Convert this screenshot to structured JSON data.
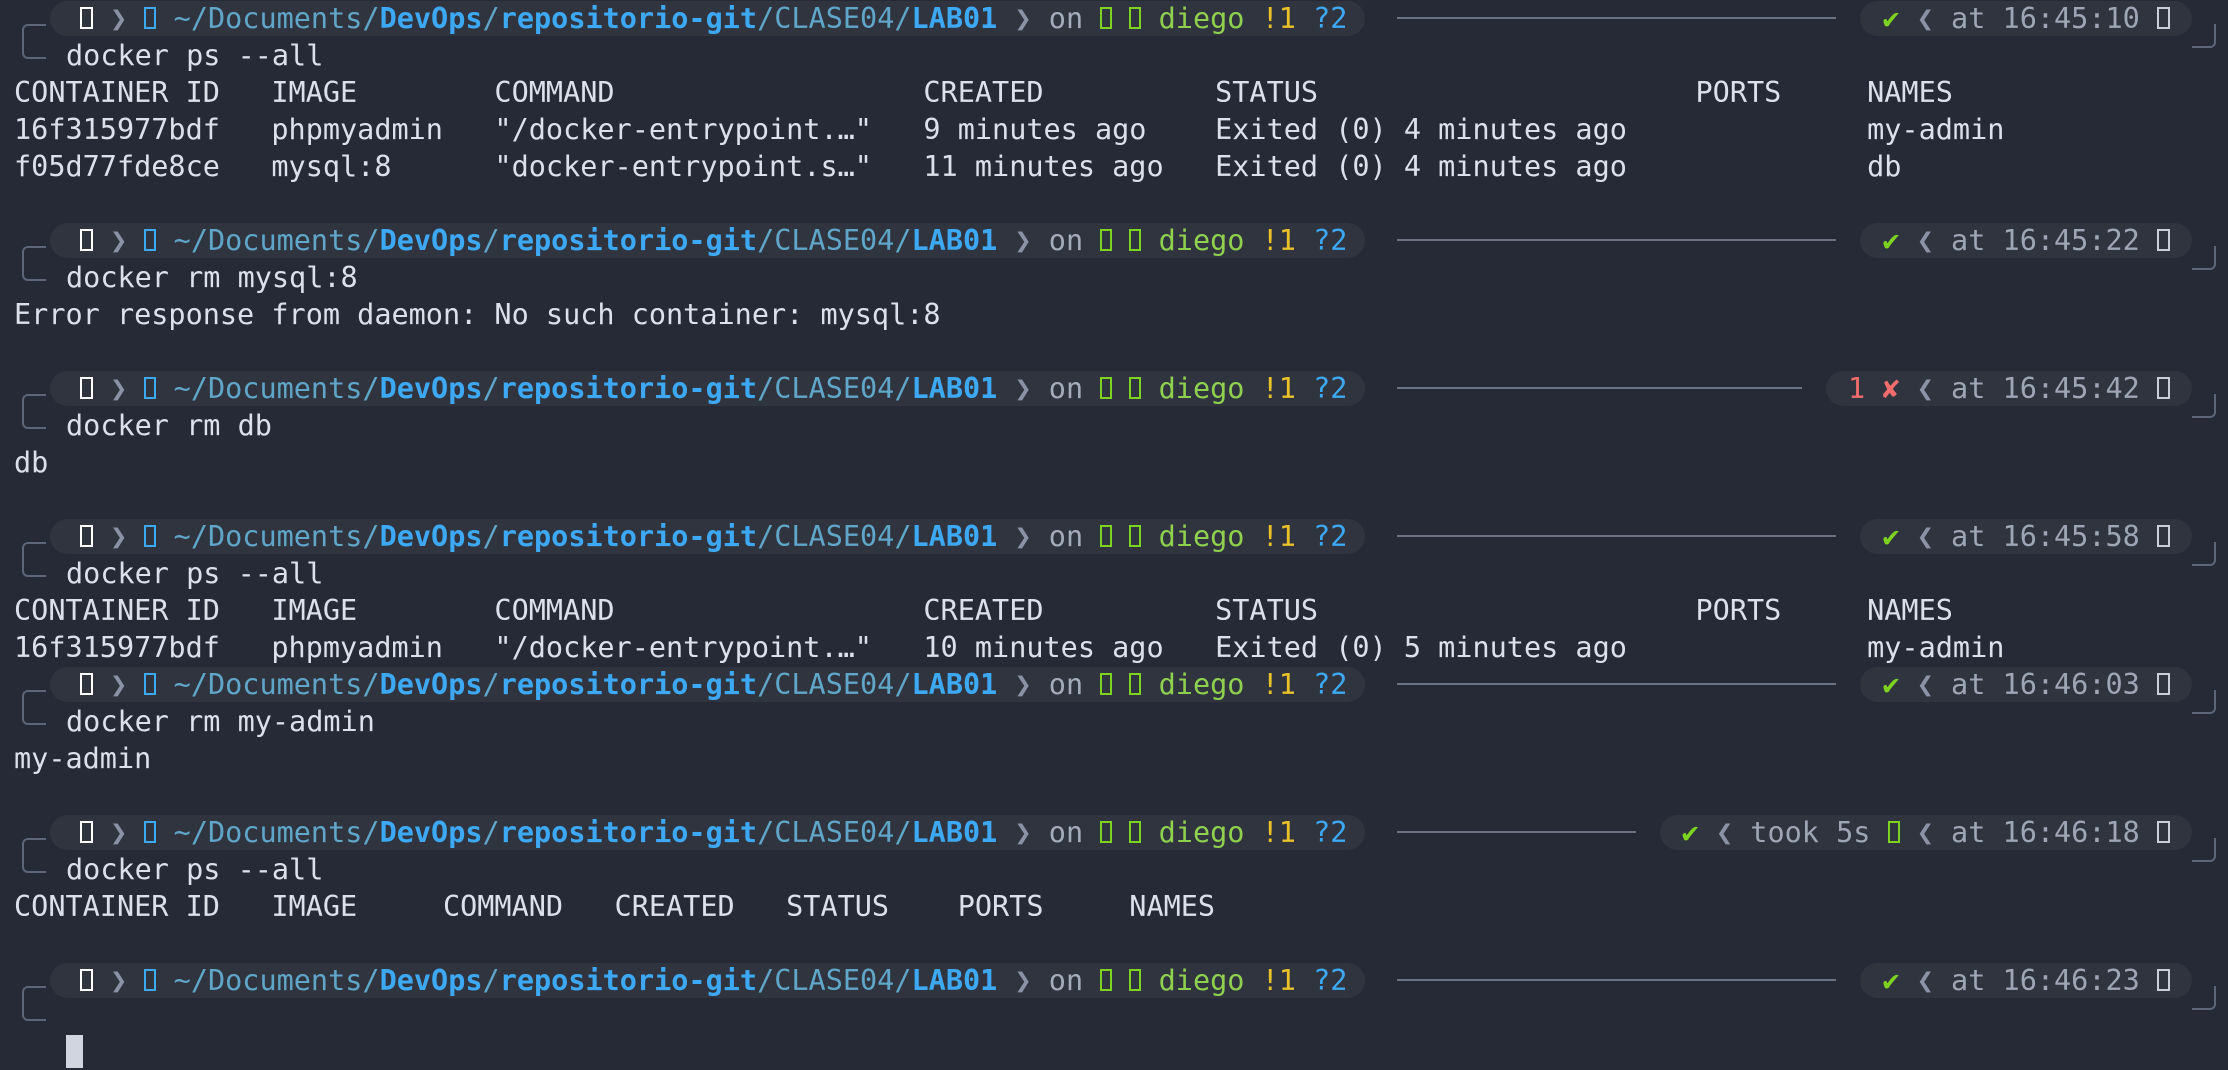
{
  "theme": {
    "background": "#262a37",
    "accent_dir": "#3da9f4",
    "ok_color": "#7ed321",
    "error_color": "#f26d6d",
    "git_dirty_color": "#e9c229"
  },
  "prompt_common": {
    "apple_icon": "apple-logo-icon",
    "folder_icon": "folder-icon",
    "path_parts": [
      "~/Documents/",
      "DevOps",
      "/",
      "repositorio-git",
      "/CLASE04/",
      "LAB01"
    ],
    "on": "on",
    "git_icons": [
      "git-icon",
      "branch-icon"
    ],
    "branch": "diego",
    "modified": "!1",
    "untracked": "?2",
    "at": "at",
    "ok_mark": "✔",
    "fail_mark": "✘",
    "clock_icon": "clock-icon"
  },
  "blocks": [
    {
      "time": "16:45:10",
      "status": "✔",
      "command": "docker ps --all",
      "output": [
        "CONTAINER ID   IMAGE        COMMAND                  CREATED          STATUS                      PORTS     NAMES",
        "16f315977bdf   phpmyadmin   \"/docker-entrypoint.…\"   9 minutes ago    Exited (0) 4 minutes ago              my-admin",
        "f05d77fde8ce   mysql:8      \"docker-entrypoint.s…\"   11 minutes ago   Exited (0) 4 minutes ago              db"
      ]
    },
    {
      "time": "16:45:22",
      "status": "✔",
      "command": "docker rm mysql:8",
      "output": [
        "Error response from daemon: No such container: mysql:8"
      ]
    },
    {
      "time": "16:45:42",
      "status_code": "1",
      "status": "✘",
      "command": "docker rm db",
      "output": [
        "db"
      ]
    },
    {
      "time": "16:45:58",
      "status": "✔",
      "command": "docker ps --all",
      "output": [
        "CONTAINER ID   IMAGE        COMMAND                  CREATED          STATUS                      PORTS     NAMES",
        "16f315977bdf   phpmyadmin   \"/docker-entrypoint.…\"   10 minutes ago   Exited (0) 5 minutes ago              my-admin"
      ]
    },
    {
      "time": "16:46:03",
      "status": "✔",
      "command": "docker rm my-admin",
      "output": [
        "my-admin"
      ]
    },
    {
      "time": "16:46:18",
      "status": "✔",
      "took": "took 5s",
      "command": "docker ps --all",
      "output": [
        "CONTAINER ID   IMAGE     COMMAND   CREATED   STATUS    PORTS     NAMES"
      ]
    },
    {
      "time": "16:46:23",
      "status": "✔",
      "command": "",
      "output": []
    }
  ]
}
